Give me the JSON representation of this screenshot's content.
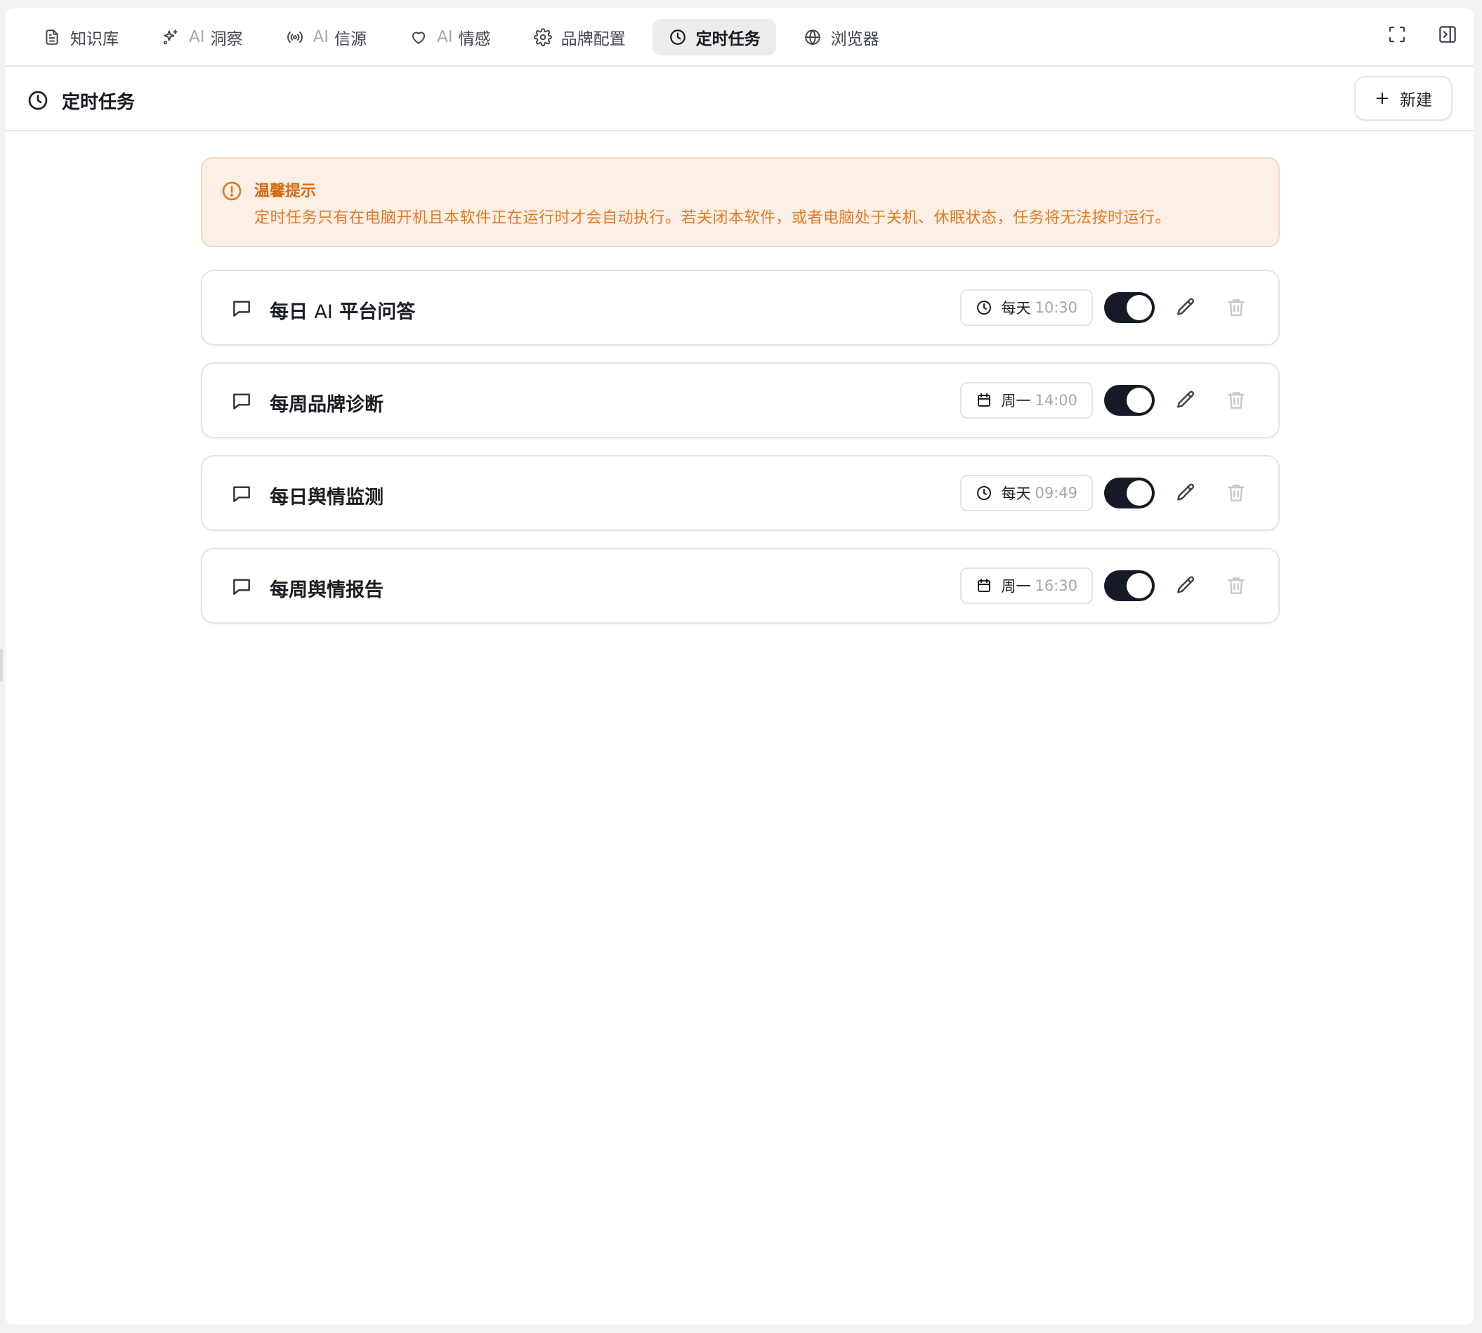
{
  "tabs": [
    {
      "icon": "document-icon",
      "prefix": "",
      "label": "知识库",
      "active": false
    },
    {
      "icon": "sparkle-icon",
      "prefix": "AI",
      "label": "洞察",
      "active": false
    },
    {
      "icon": "broadcast-icon",
      "prefix": "AI",
      "label": "信源",
      "active": false
    },
    {
      "icon": "heart-icon",
      "prefix": "AI",
      "label": "情感",
      "active": false
    },
    {
      "icon": "gear-icon",
      "prefix": "",
      "label": "品牌配置",
      "active": false
    },
    {
      "icon": "clock-icon",
      "prefix": "",
      "label": "定时任务",
      "active": true
    },
    {
      "icon": "globe-icon",
      "prefix": "",
      "label": "浏览器",
      "active": false
    }
  ],
  "header": {
    "title": "定时任务",
    "new_button": "新建"
  },
  "notice": {
    "title": "温馨提示",
    "body": "定时任务只有在电脑开机且本软件正在运行时才会自动执行。若关闭本软件，或者电脑处于关机、休眠状态，任务将无法按时运行。"
  },
  "tasks": [
    {
      "name_parts": [
        "每日 ",
        "AI",
        " 平台问答"
      ],
      "schedule_icon": "clock-icon",
      "freq": "每天",
      "time": "10:30",
      "enabled": true
    },
    {
      "name_parts": [
        "每周品牌诊断"
      ],
      "schedule_icon": "calendar-icon",
      "freq": "周一",
      "time": "14:00",
      "enabled": true
    },
    {
      "name_parts": [
        "每日舆情监测"
      ],
      "schedule_icon": "clock-icon",
      "freq": "每天",
      "time": "09:49",
      "enabled": true
    },
    {
      "name_parts": [
        "每周舆情报告"
      ],
      "schedule_icon": "calendar-icon",
      "freq": "周一",
      "time": "16:30",
      "enabled": true
    }
  ],
  "colors": {
    "accent_dark": "#151a26",
    "notice_bg": "#fcefe6",
    "notice_text": "#e07b24",
    "notice_title": "#d9690f",
    "active_tab_bg": "#ececed"
  }
}
